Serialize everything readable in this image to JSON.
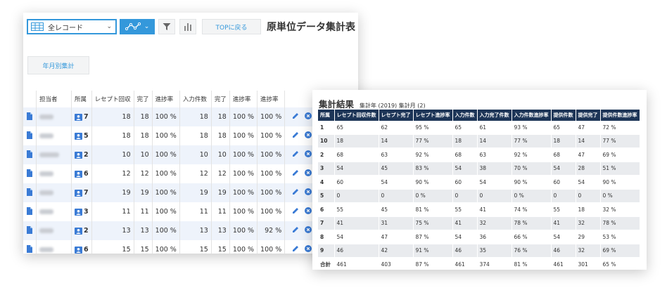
{
  "toolbar": {
    "view_select": "全レコード",
    "top_button": "TOPに戻る",
    "app_title": "原単位データ集計表",
    "yearly_button": "年月別集計"
  },
  "colors": {
    "accent": "#3498db",
    "header_dark": "#1d3557",
    "row_stripe": "#eef3fb"
  },
  "icons": {
    "view": "grid-icon",
    "graph": "line-graph-icon",
    "filter": "funnel-icon",
    "chart": "bar-chart-icon",
    "record": "document-icon",
    "affiliation": "person-card-icon",
    "edit": "pencil-icon",
    "delete": "close-circle-icon"
  },
  "records": {
    "columns": [
      "担当者",
      "所属",
      "レセプト回収",
      "完了",
      "進捗率",
      "入力件数",
      "完了",
      "進捗率",
      "進捗率"
    ],
    "rows": [
      {
        "affil": "7",
        "receipt": "18",
        "done": "18",
        "rate": "100 %",
        "input": "18",
        "done2": "18",
        "rate2": "100 %",
        "rate3": "100 %"
      },
      {
        "affil": "5",
        "receipt": "18",
        "done": "18",
        "rate": "100 %",
        "input": "18",
        "done2": "18",
        "rate2": "100 %",
        "rate3": "100 %"
      },
      {
        "affil": "2",
        "receipt": "10",
        "done": "10",
        "rate": "100 %",
        "input": "10",
        "done2": "10",
        "rate2": "100 %",
        "rate3": "100 %"
      },
      {
        "affil": "6",
        "receipt": "12",
        "done": "12",
        "rate": "100 %",
        "input": "12",
        "done2": "12",
        "rate2": "100 %",
        "rate3": "100 %"
      },
      {
        "affil": "7",
        "receipt": "19",
        "done": "19",
        "rate": "100 %",
        "input": "19",
        "done2": "19",
        "rate2": "100 %",
        "rate3": "100 %"
      },
      {
        "affil": "3",
        "receipt": "11",
        "done": "11",
        "rate": "100 %",
        "input": "11",
        "done2": "11",
        "rate2": "100 %",
        "rate3": "100 %"
      },
      {
        "affil": "2",
        "receipt": "13",
        "done": "13",
        "rate": "100 %",
        "input": "13",
        "done2": "13",
        "rate2": "100 %",
        "rate3": "92 %"
      },
      {
        "affil": "6",
        "receipt": "15",
        "done": "15",
        "rate": "100 %",
        "input": "15",
        "done2": "15",
        "rate2": "100 %",
        "rate3": "100 %"
      }
    ]
  },
  "summary": {
    "title": "集計結果",
    "subtitle": "集計年 (2019) 集計月 (2)",
    "columns": [
      "所属",
      "レセプト回収件数",
      "レセプト完了",
      "レセプト進捗率",
      "入力件数",
      "入力完了件数",
      "入力件数進捗率",
      "提供件数",
      "提供完了",
      "提供件数進捗率"
    ],
    "rows": [
      [
        "1",
        "65",
        "62",
        "95 %",
        "65",
        "61",
        "93 %",
        "65",
        "47",
        "72 %"
      ],
      [
        "10",
        "18",
        "14",
        "77 %",
        "18",
        "14",
        "77 %",
        "18",
        "14",
        "77 %"
      ],
      [
        "2",
        "68",
        "63",
        "92 %",
        "68",
        "63",
        "92 %",
        "68",
        "47",
        "69 %"
      ],
      [
        "3",
        "54",
        "45",
        "83 %",
        "54",
        "38",
        "70 %",
        "54",
        "28",
        "51 %"
      ],
      [
        "4",
        "60",
        "54",
        "90 %",
        "60",
        "54",
        "90 %",
        "60",
        "54",
        "90 %"
      ],
      [
        "5",
        "0",
        "0",
        "0 %",
        "0",
        "0",
        "0 %",
        "0",
        "0",
        "0 %"
      ],
      [
        "6",
        "55",
        "45",
        "81 %",
        "55",
        "41",
        "74 %",
        "55",
        "18",
        "32 %"
      ],
      [
        "7",
        "41",
        "31",
        "75 %",
        "41",
        "32",
        "78 %",
        "41",
        "32",
        "78 %"
      ],
      [
        "8",
        "54",
        "47",
        "87 %",
        "54",
        "36",
        "66 %",
        "54",
        "29",
        "53 %"
      ],
      [
        "9",
        "46",
        "42",
        "91 %",
        "46",
        "35",
        "76 %",
        "46",
        "32",
        "69 %"
      ],
      [
        "合計",
        "461",
        "403",
        "87 %",
        "461",
        "374",
        "81 %",
        "461",
        "301",
        "65 %"
      ]
    ]
  }
}
